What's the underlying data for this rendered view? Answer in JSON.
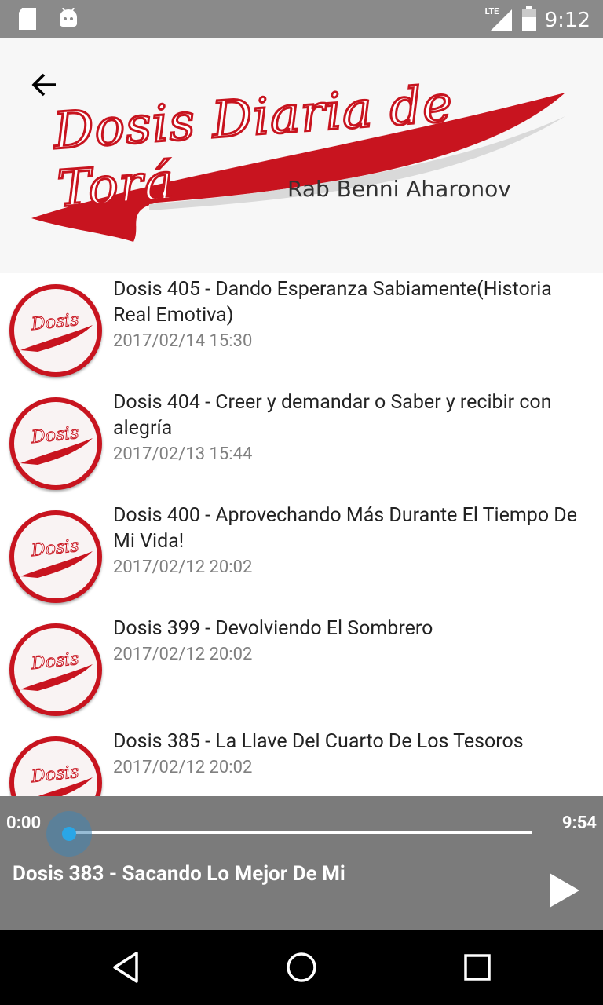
{
  "status_bar": {
    "time": "9:12",
    "network": "LTE",
    "left_icons": [
      "sd-card-icon",
      "android-icon"
    ],
    "right_icons": [
      "lte-signal-icon",
      "battery-icon"
    ]
  },
  "header": {
    "logo_title": "Dosis Diaria de Torá",
    "logo_subtitle": "Rab Benni Aharonov",
    "back_icon": "arrow-left-icon"
  },
  "episodes": [
    {
      "title": "Dosis 405 - Dando Esperanza Sabiamente(Historia Real Emotiva)",
      "date": "2017/02/14 15:30"
    },
    {
      "title": "Dosis 404 - Creer y demandar o Saber y recibir con alegría",
      "date": "2017/02/13 15:44"
    },
    {
      "title": "Dosis 400 - Aprovechando Más Durante El Tiempo De Mi Vida!",
      "date": "2017/02/12 20:02"
    },
    {
      "title": "Dosis 399 - Devolviendo El Sombrero",
      "date": "2017/02/12 20:02"
    },
    {
      "title": "Dosis 385 - La Llave Del Cuarto De Los Tesoros",
      "date": "2017/02/12 20:02"
    }
  ],
  "thumbnail_label": "Dosis",
  "player": {
    "current_time": "0:00",
    "duration": "9:54",
    "progress": 0.0,
    "now_playing": "Dosis 383 - Sacando Lo Mejor De Mi",
    "play_icon": "play-icon"
  },
  "colors": {
    "brand_red": "#c8141f",
    "status_bar": "#8a8a8a",
    "player_bg": "#7b7b7b",
    "seek_accent": "#2aa6e6"
  }
}
